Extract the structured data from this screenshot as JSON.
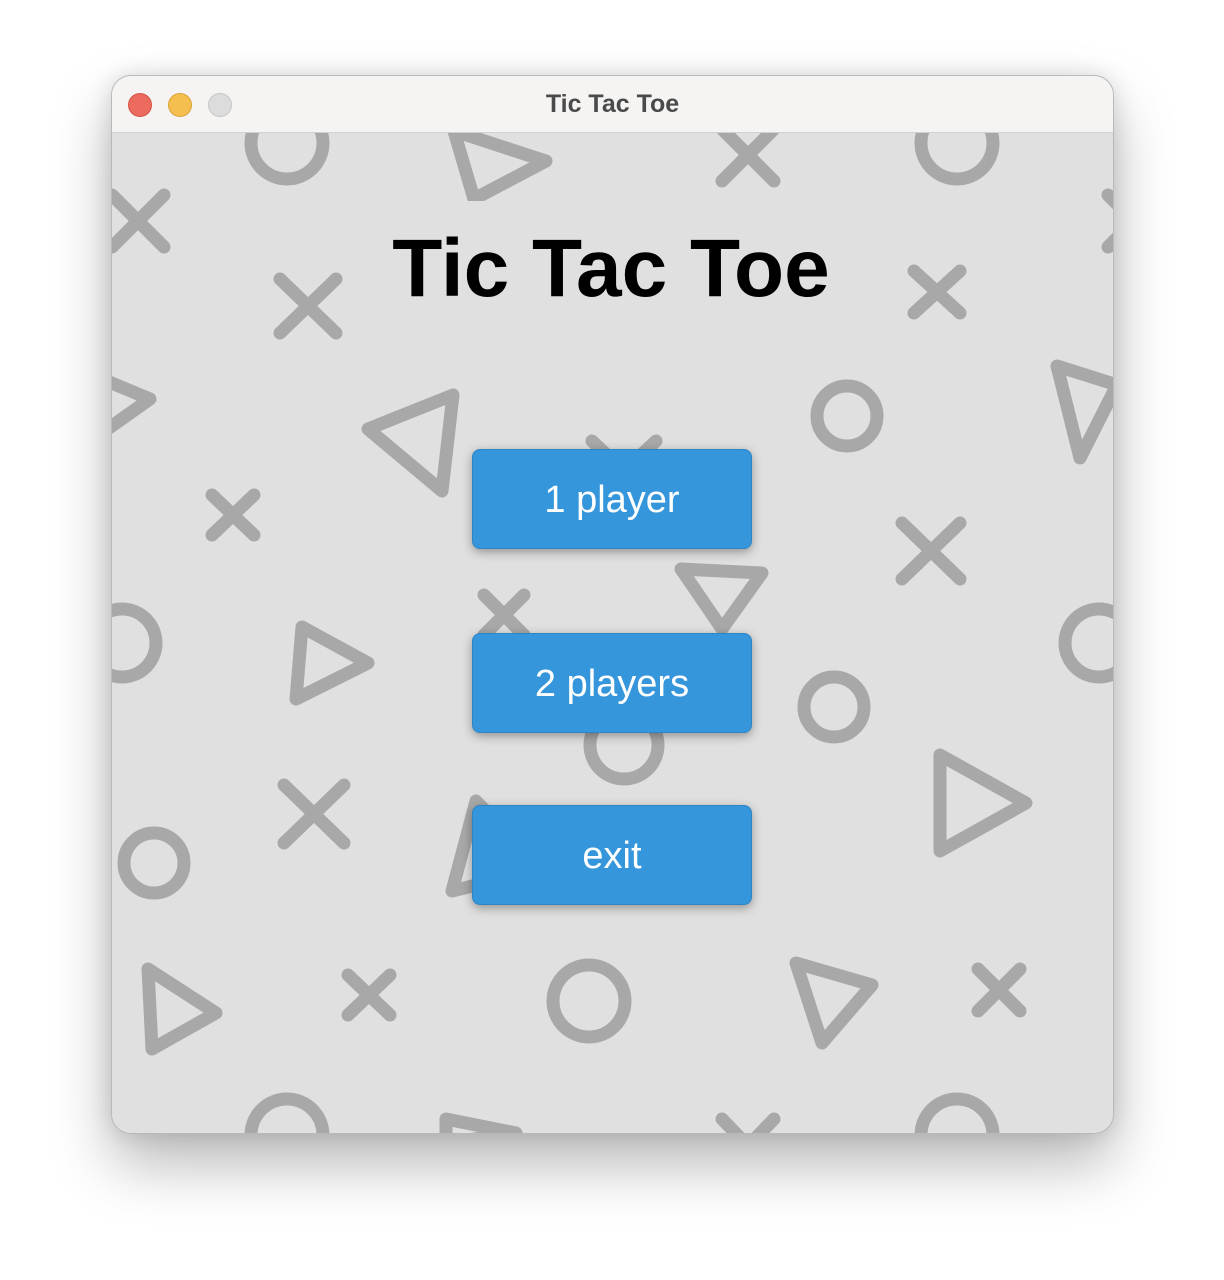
{
  "window": {
    "title": "Tic Tac Toe",
    "controls": [
      "close-icon",
      "minimize-icon",
      "zoom-icon"
    ]
  },
  "main": {
    "heading": "Tic Tac Toe",
    "buttons": [
      {
        "label": "1 player"
      },
      {
        "label": "2 players"
      },
      {
        "label": "exit"
      }
    ]
  },
  "colors": {
    "button_bg": "#3596db",
    "button_text": "#ffffff",
    "background": "#e0e0e0",
    "pattern": "#a8a8a8",
    "title_text": "#000000"
  }
}
